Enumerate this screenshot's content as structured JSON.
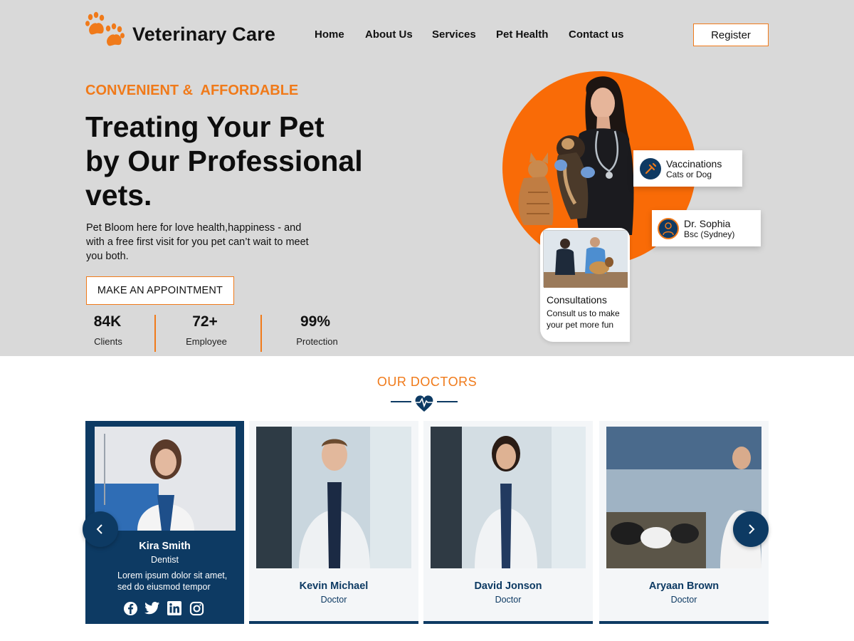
{
  "brand": {
    "name": "Veterinary Care",
    "logo_icon": "paw-icon",
    "accent": "#f07a1a"
  },
  "nav": {
    "items": [
      "Home",
      "About Us",
      "Services",
      "Pet Health",
      "Contact us"
    ],
    "register_label": "Register"
  },
  "hero": {
    "tagline": "CONVENIENT &  AFFORDABLE",
    "headline_lines": [
      "Treating Your Pet",
      "by Our Professional",
      "vets."
    ],
    "description": "Pet Bloom here for love health,happiness - and with a free first visit for you pet can’t wait to meet you both.",
    "cta_label": "MAKE AN APPOINTMENT",
    "stats": [
      {
        "value": "84K",
        "label": "Clients"
      },
      {
        "value": "72+",
        "label": "Employee"
      },
      {
        "value": "99%",
        "label": "Protection"
      }
    ],
    "circle_color": "#f96b07"
  },
  "badges": {
    "vaccinations": {
      "title": "Vaccinations",
      "subtitle": "Cats or Dog",
      "icon": "syringe-icon"
    },
    "doctor": {
      "title": "Dr. Sophia",
      "subtitle": "Bsc (Sydney)",
      "icon": "doctor-icon"
    },
    "consultations": {
      "title": "Consultations",
      "text": "Consult us to make your pet more fun"
    }
  },
  "doctors_section": {
    "title": "OUR DOCTORS",
    "featured": {
      "name": "Kira Smith",
      "role": "Dentist",
      "text": "Lorem ipsum dolor sit amet, sed do eiusmod tempor",
      "socials": [
        "facebook-icon",
        "twitter-icon",
        "linkedin-icon",
        "instagram-icon"
      ]
    },
    "cards": [
      {
        "name": "Kevin Michael",
        "role": "Doctor"
      },
      {
        "name": "David Jonson",
        "role": "Doctor"
      },
      {
        "name": "Aryaan Brown",
        "role": "Doctor"
      }
    ],
    "primary_color": "#0d3a63"
  }
}
